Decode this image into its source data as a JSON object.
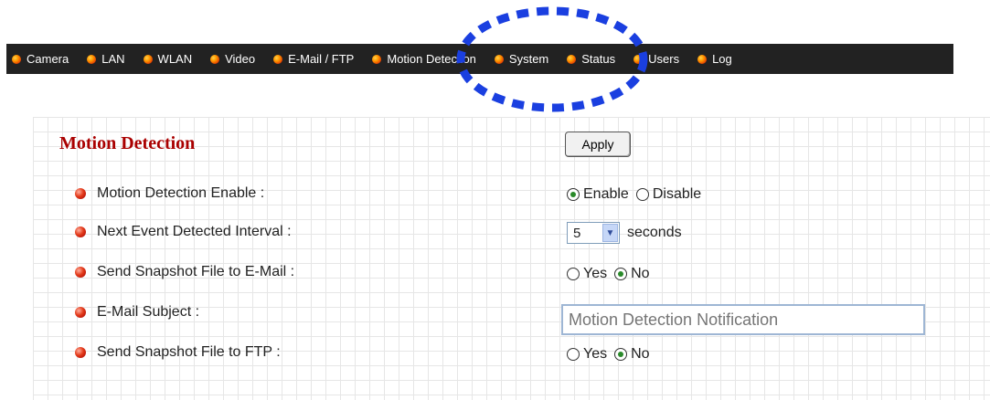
{
  "nav": {
    "items": [
      "Camera",
      "LAN",
      "WLAN",
      "Video",
      "E-Mail / FTP",
      "Motion Detection",
      "System",
      "Status",
      "Users",
      "Log"
    ]
  },
  "colors": {
    "nav_bg": "#222222",
    "title": "#aa0000",
    "highlight": "#1a3fe0"
  },
  "panel": {
    "title": "Motion Detection",
    "apply_label": "Apply",
    "rows": [
      {
        "label": "Motion Detection Enable :",
        "options": [
          "Enable",
          "Disable"
        ],
        "selected": "Enable"
      },
      {
        "label": "Next Event Detected Interval :",
        "value": "5",
        "unit": "seconds"
      },
      {
        "label": "Send Snapshot File to E-Mail :",
        "options": [
          "Yes",
          "No"
        ],
        "selected": "No"
      },
      {
        "label": "E-Mail Subject :",
        "placeholder": "Motion Detection Notification"
      },
      {
        "label": "Send Snapshot File to FTP :",
        "options": [
          "Yes",
          "No"
        ],
        "selected": "No"
      }
    ]
  }
}
